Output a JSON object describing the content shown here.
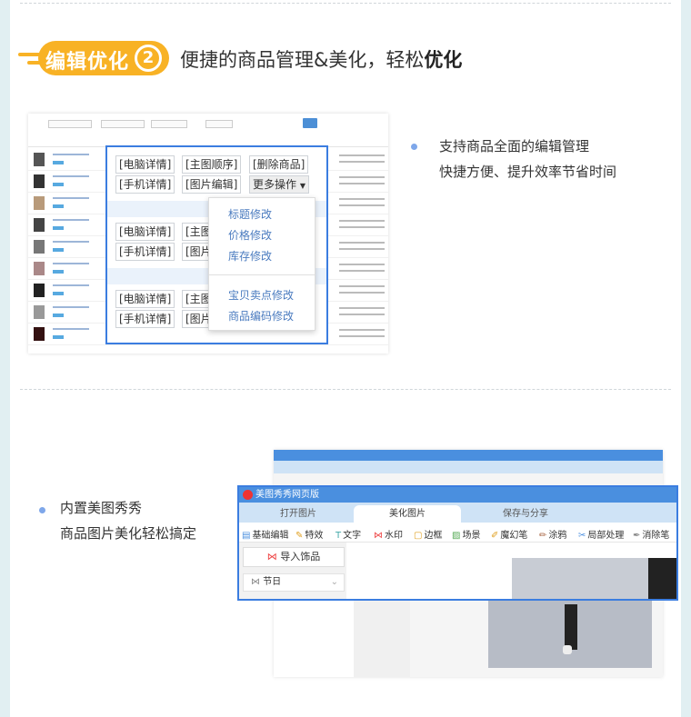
{
  "section": {
    "badge_label": "编辑优化",
    "badge_number": "2",
    "heading_main": "便捷的商品管理&美化，轻松",
    "heading_bold": "优化"
  },
  "feature1": {
    "line1": "支持商品全面的编辑管理",
    "line2": "快捷方便、提升效率节省时间"
  },
  "feature2": {
    "line1": "内置美图秀秀",
    "line2": "商品图片美化轻松搞定"
  },
  "edit_buttons": {
    "pc_detail": "[电脑详情]",
    "main_order": "[主图顺序]",
    "delete_item": "[删除商品]",
    "mobile_detail": "[手机详情]",
    "image_edit": "[图片编辑]",
    "more_ops": "更多操作",
    "pc_detail_short": "[电脑详情]",
    "main_short": "[主图",
    "mobile_short": "[手机详情]",
    "image_short": "[图片"
  },
  "dropdown": [
    "标题修改",
    "价格修改",
    "库存修改",
    "宝贝卖点修改",
    "商品编码修改"
  ],
  "meitu": {
    "title": "美图秀秀网页版",
    "tabs": [
      "打开图片",
      "美化图片",
      "保存与分享"
    ],
    "tools": [
      "基础编辑",
      "特效",
      "文字",
      "水印",
      "边框",
      "场景",
      "魔幻笔",
      "涂鸦",
      "局部处理",
      "消除笔"
    ],
    "import_button": "导入饰品",
    "category": "节日"
  },
  "colors": {
    "accent": "#3b7de0",
    "badge": "#f8b225",
    "background": "#e1eff2"
  }
}
